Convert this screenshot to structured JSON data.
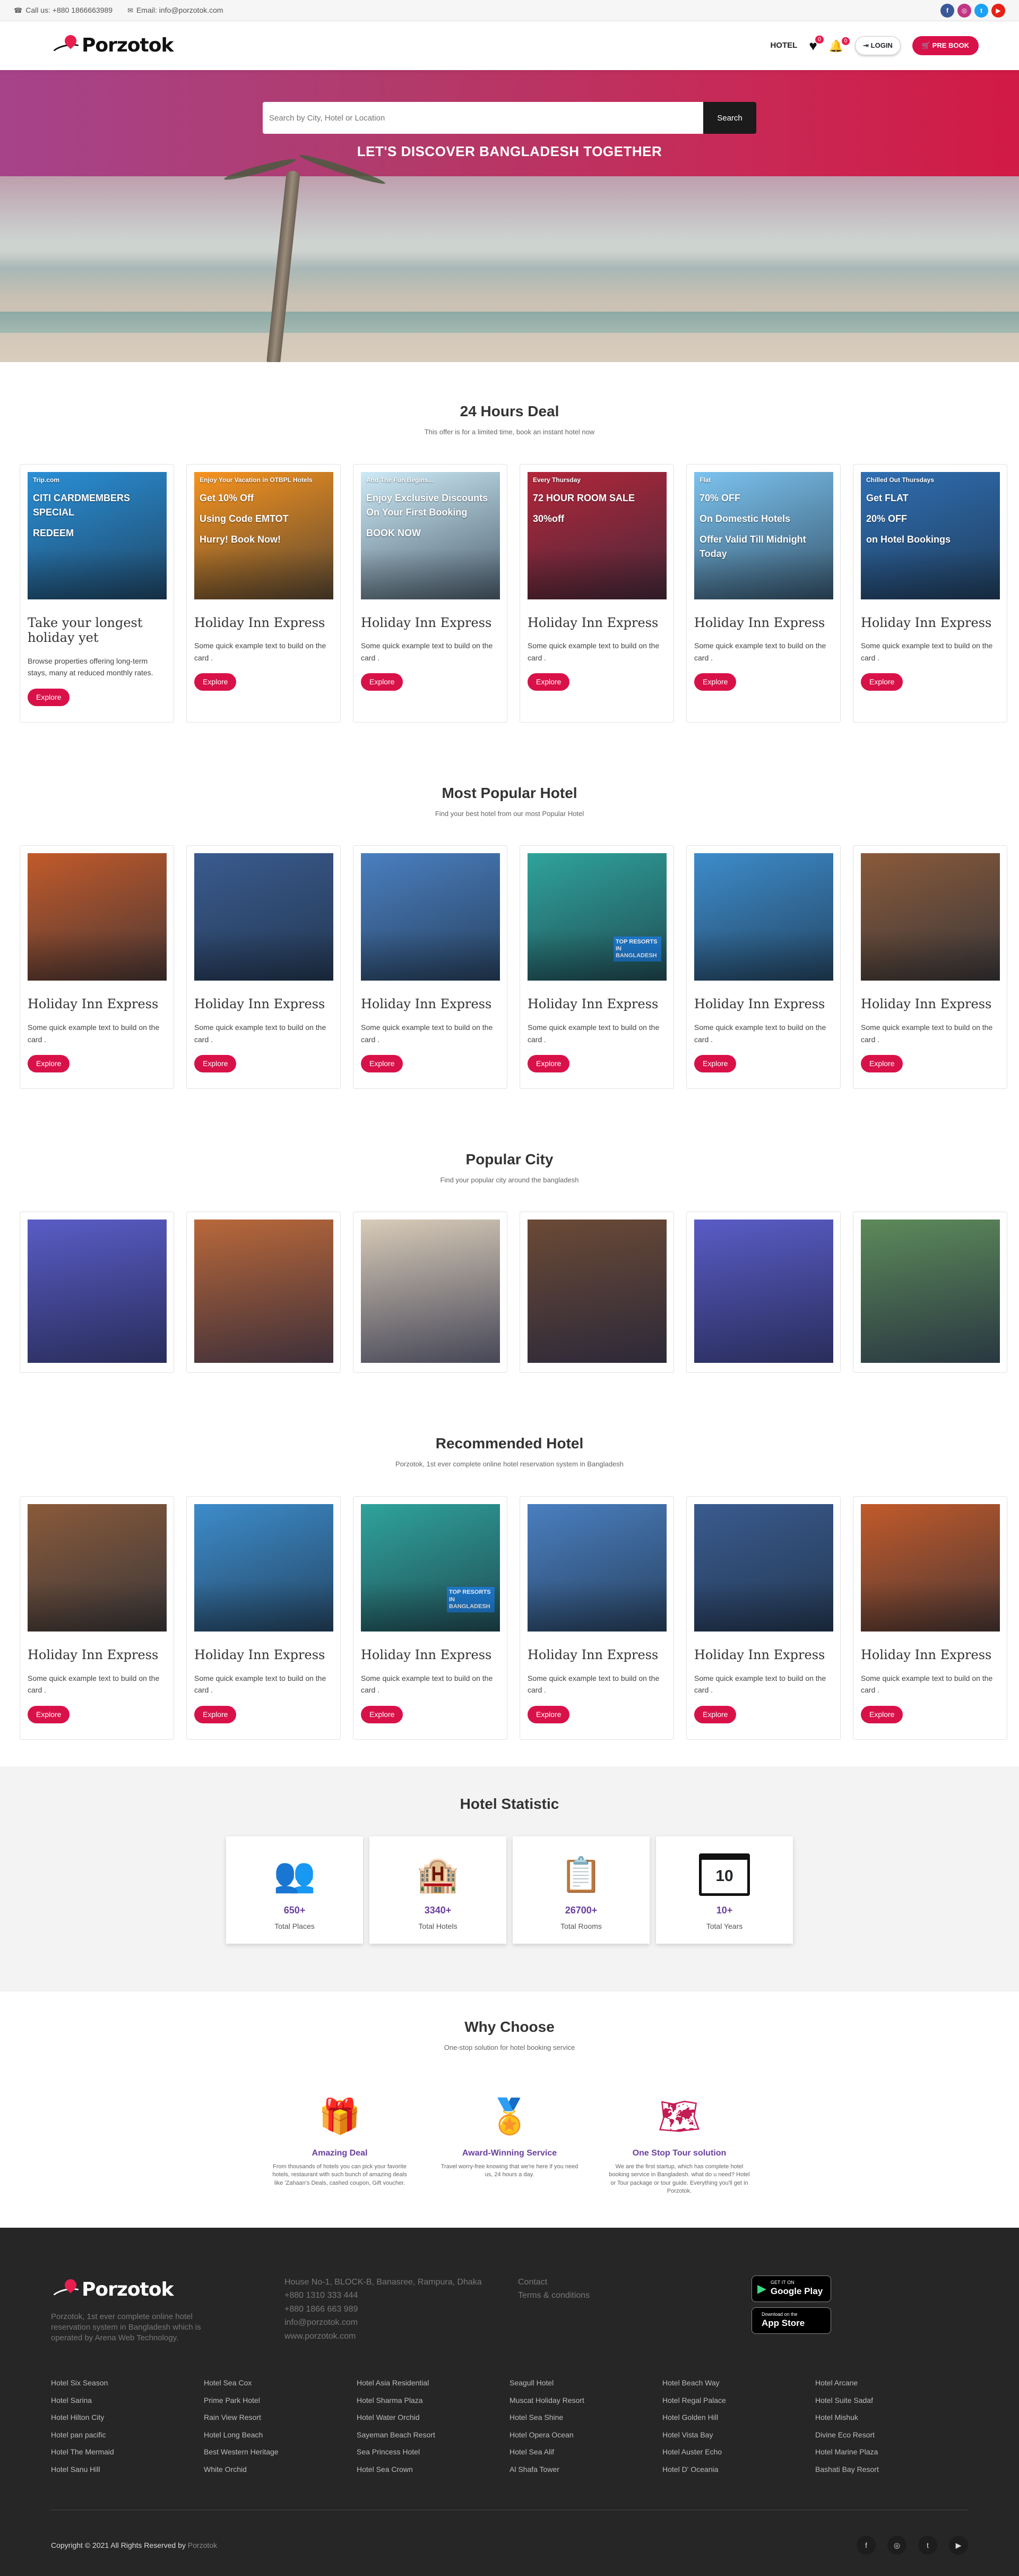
{
  "topbar": {
    "phone": "Call us: +880 1866663989",
    "email": "Email: info@porzotok.com",
    "social": [
      {
        "icon": "facebook-icon",
        "glyph": "f",
        "color": "#3b5998"
      },
      {
        "icon": "instagram-icon",
        "glyph": "◎",
        "color": "#c13584"
      },
      {
        "icon": "twitter-icon",
        "glyph": "t",
        "color": "#1da1f2"
      },
      {
        "icon": "youtube-icon",
        "glyph": "▶",
        "color": "#e62117"
      }
    ]
  },
  "nav": {
    "brand": "Porzotok",
    "hotel": "HOTEL",
    "wishlist_count": "0",
    "notif_count": "0",
    "login": "LOGIN",
    "prebook": "PRE BOOK"
  },
  "hero": {
    "search_placeholder": "Search by City, Hotel or Location",
    "search_button": "Search",
    "tagline": "LET'S DISCOVER BANGLADESH TOGETHER"
  },
  "deals": {
    "title": "24 Hours Deal",
    "subtitle": "This offer is for a limited time, book an instant hotel now",
    "cards": [
      {
        "title": "Take your longest holiday yet",
        "text": "Browse properties offering long-term stays, many at reduced monthly rates.",
        "button": "Explore",
        "img_lines": [
          "Trip.com",
          "CITI CARDMEMBERS SPECIAL",
          "REDEEM"
        ],
        "bg": "#2a8fd6"
      },
      {
        "title": "Holiday Inn Express",
        "text": "Some quick example text to build on the card .",
        "button": "Explore",
        "img_lines": [
          "Enjoy Your Vacation in OTBPL Hotels",
          "Get 10% Off",
          "Using Code EMTOT",
          "Hurry! Book Now!"
        ],
        "bg": "#f7931e"
      },
      {
        "title": "Holiday Inn Express",
        "text": "Some quick example text to build on the card .",
        "button": "Explore",
        "img_lines": [
          "And The Fun Begins...",
          "Enjoy Exclusive Discounts On Your First Booking",
          "BOOK NOW"
        ],
        "bg": "#cdeaf7"
      },
      {
        "title": "Holiday Inn Express",
        "text": "Some quick example text to build on the card .",
        "button": "Explore",
        "img_lines": [
          "Every Thursday",
          "72 HOUR ROOM SALE",
          "30%off"
        ],
        "bg": "#b3263a"
      },
      {
        "title": "Holiday Inn Express",
        "text": "Some quick example text to build on the card .",
        "button": "Explore",
        "img_lines": [
          "Flat",
          "70% OFF",
          "On Domestic Hotels",
          "Offer Valid Till Midnight Today"
        ],
        "bg": "#7cc3ef"
      },
      {
        "title": "Holiday Inn Express",
        "text": "Some quick example text to build on the card .",
        "button": "Explore",
        "img_lines": [
          "Chilled Out Thursdays",
          "Get FLAT",
          "20% OFF",
          "on Hotel Bookings"
        ],
        "bg": "#2f6fb3"
      }
    ]
  },
  "popular": {
    "title": "Most Popular Hotel",
    "subtitle": "Find your best hotel from our most Popular Hotel",
    "cards": [
      {
        "title": "Holiday Inn Express",
        "text": "Some quick example text to build on the card .",
        "button": "Explore",
        "bg": "#c25a2a"
      },
      {
        "title": "Holiday Inn Express",
        "text": "Some quick example text to build on the card .",
        "button": "Explore",
        "bg": "#3a5b8f"
      },
      {
        "title": "Holiday Inn Express",
        "text": "Some quick example text to build on the card .",
        "button": "Explore",
        "bg": "#4a7fc0"
      },
      {
        "title": "Holiday Inn Express",
        "text": "Some quick example text to build on the card .",
        "button": "Explore",
        "bg": "#2fa39b",
        "tag": "TOP RESORTS IN BANGLADESH"
      },
      {
        "title": "Holiday Inn Express",
        "text": "Some quick example text to build on the card .",
        "button": "Explore",
        "bg": "#3d8ccb"
      },
      {
        "title": "Holiday Inn Express",
        "text": "Some quick example text to build on the card .",
        "button": "Explore",
        "bg": "#8a5a3a"
      }
    ]
  },
  "city": {
    "title": "Popular City",
    "subtitle": "Find your popular city around the bangladesh",
    "cards": [
      {
        "bg": "#5a5cc6"
      },
      {
        "bg": "#b9683a"
      },
      {
        "bg": "#d8cbb8"
      },
      {
        "bg": "#6b4a36"
      },
      {
        "bg": "#5a5cc6"
      },
      {
        "bg": "#5d8a5a"
      }
    ]
  },
  "recommended": {
    "title": "Recommended Hotel",
    "subtitle": "Porzotok, 1st ever complete online hotel reservation system in Bangladesh",
    "cards": [
      {
        "title": "Holiday Inn Express",
        "text": "Some quick example text to build on the card .",
        "button": "Explore",
        "bg": "#8a5a3a"
      },
      {
        "title": "Holiday Inn Express",
        "text": "Some quick example text to build on the card .",
        "button": "Explore",
        "bg": "#3d8ccb"
      },
      {
        "title": "Holiday Inn Express",
        "text": "Some quick example text to build on the card .",
        "button": "Explore",
        "bg": "#2fa39b",
        "tag": "TOP RESORTS IN BANGLADESH"
      },
      {
        "title": "Holiday Inn Express",
        "text": "Some quick example text to build on the card .",
        "button": "Explore",
        "bg": "#4a7fc0"
      },
      {
        "title": "Holiday Inn Express",
        "text": "Some quick example text to build on the card .",
        "button": "Explore",
        "bg": "#3a5b8f"
      },
      {
        "title": "Holiday Inn Express",
        "text": "Some quick example text to build on the card .",
        "button": "Explore",
        "bg": "#c25a2a"
      }
    ]
  },
  "stats": {
    "title": "Hotel Statistic",
    "items": [
      {
        "icon": "people-icon",
        "glyph": "👥",
        "num": "650+",
        "label": "Total Places"
      },
      {
        "icon": "hotel-building-icon",
        "glyph": "🏨",
        "num": "3340+",
        "label": "Total Hotels"
      },
      {
        "icon": "clipboard-check-icon",
        "glyph": "📋",
        "num": "26700+",
        "label": "Total Rooms"
      },
      {
        "icon": "calendar-icon",
        "glyph": "10",
        "num": "10+",
        "label": "Total Years"
      }
    ]
  },
  "why": {
    "title": "Why Choose",
    "subtitle": "One-stop solution for hotel booking service",
    "items": [
      {
        "icon": "gift-icon",
        "glyph": "🎁",
        "title": "Amazing Deal",
        "text": "From thousands of hotels you can pick your favorite hotels, restaurant with such bunch of amazing deals like 'Zahaan's Deals, cashed coupon, Gift voucher."
      },
      {
        "icon": "award-icon",
        "glyph": "🏅",
        "title": "Award-Winning Service",
        "text": "Travel worry-free knowing that we're here if you need us, 24 hours a day."
      },
      {
        "icon": "map-icon",
        "glyph": "🗺",
        "title": "One Stop Tour solution",
        "text": "We are the first startup, which has complete hotel booking service in Bangladesh. what do u need? Hotel or Tour package or tour guide. Everything you'll get in Porzotok."
      }
    ]
  },
  "footer": {
    "brand": "Porzotok",
    "about": "Porzotok, 1st ever complete online hotel reservation system in Bangladesh which is operated by Arena Web Technology.",
    "address": [
      "House No-1, BLOCK-B, Banasree, Rampura, Dhaka",
      "+880 1310 333 444",
      "+880 1866 663 989",
      "info@porzotok.com",
      "www.porzotok.com"
    ],
    "links": [
      "Contact",
      "Terms & conditions"
    ],
    "google_play_top": "GET IT ON",
    "google_play": "Google Play",
    "app_store_top": "Download on the",
    "app_store": "App Store",
    "columns": [
      [
        "Hotel Six Season",
        "Hotel Sarina",
        "Hotel Hilton City",
        "Hotel pan pacific",
        "Hotel The Mermaid",
        "Hotel Sanu Hill"
      ],
      [
        "Hotel Sea Cox",
        "Prime Park Hotel",
        "Rain View Resort",
        "Hotel Long Beach",
        "Best Western Heritage",
        "White Orchid"
      ],
      [
        "Hotel Asia Residential",
        "Hotel Sharma Plaza",
        "Hotel Water Orchid",
        "Sayeman Beach Resort",
        "Sea Princess Hotel",
        "Hotel Sea Crown"
      ],
      [
        "Seagull Hotel",
        "Muscat Holiday Resort",
        "Hotel Sea Shine",
        "Hotel Opera Ocean",
        "Hotel Sea Alif",
        "Al Shafa Tower"
      ],
      [
        "Hotel Beach Way",
        "Hotel Regal Palace",
        "Hotel Golden Hill",
        "Hotel Vista Bay",
        "Hotel Auster Echo",
        "Hotel D' Oceania"
      ],
      [
        "Hotel Arcane",
        "Hotel Suite Sadaf",
        "Hotel Mishuk",
        "Divine Eco Resort",
        "Hotel Marine Plaza",
        "Bashati Bay Resort"
      ]
    ],
    "copyright": "Copyright © 2021 All Rights Reserved by",
    "copyright_brand": "Porzotok"
  }
}
